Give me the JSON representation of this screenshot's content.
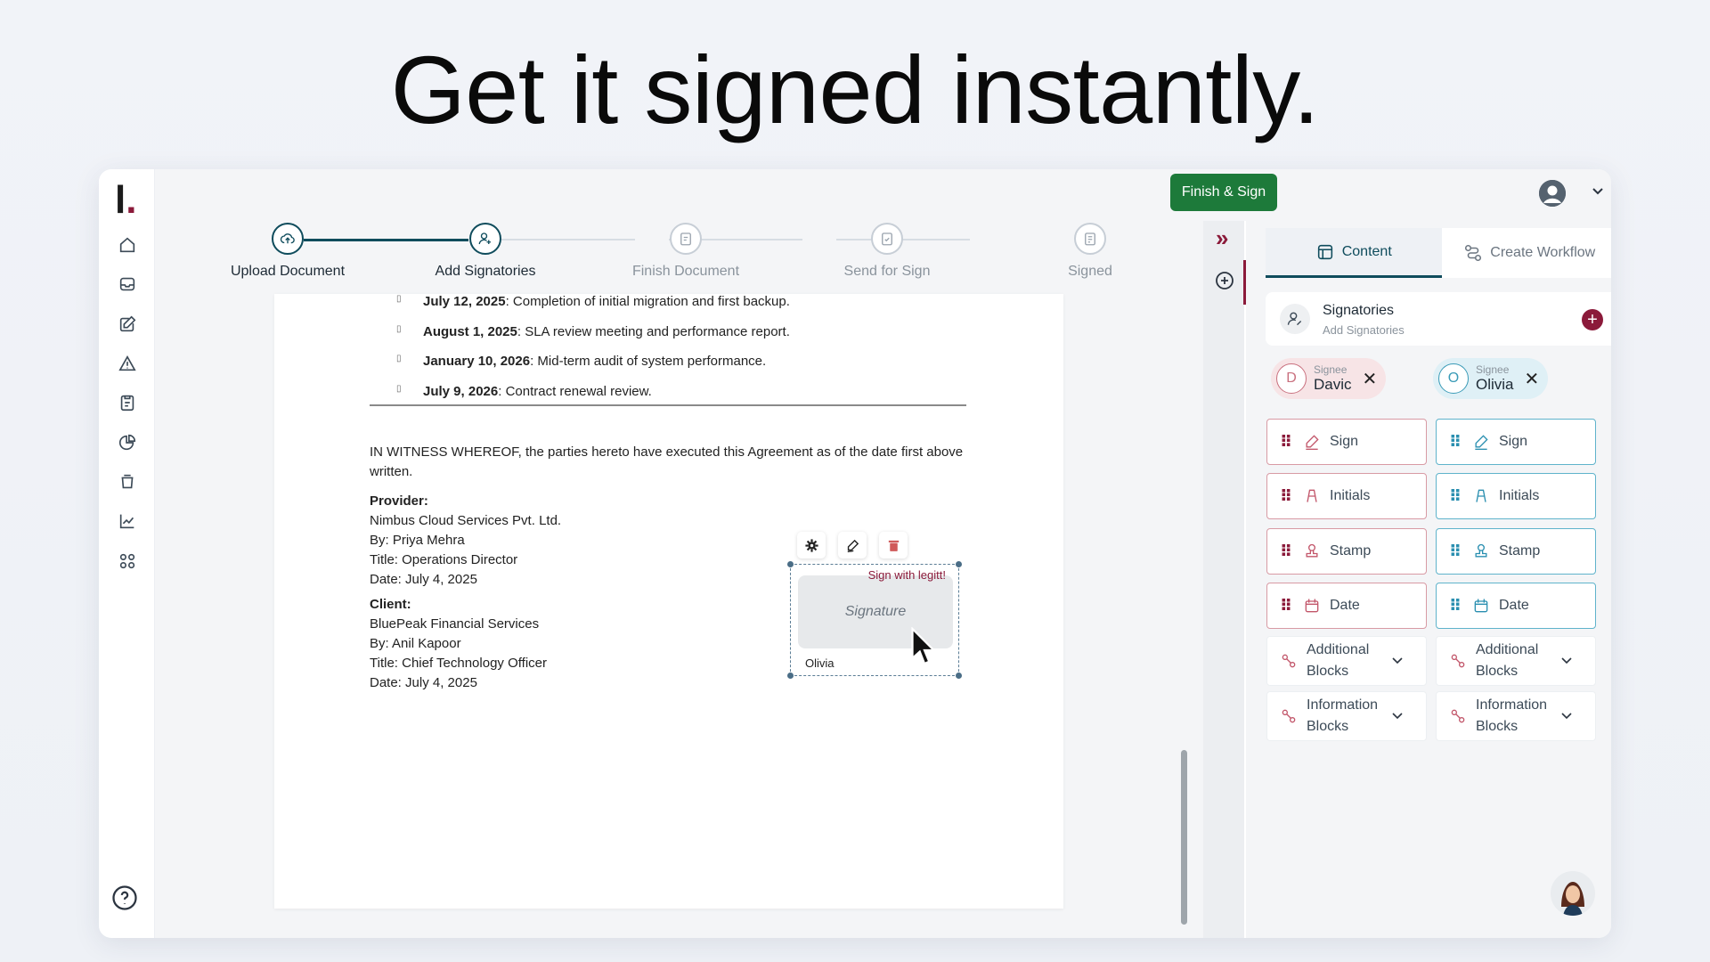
{
  "headline": "Get it signed instantly.",
  "app": {
    "logo": "l.",
    "finish_sign_label": "Finish & Sign"
  },
  "stepper": [
    {
      "label": "Upload Document",
      "state": "done"
    },
    {
      "label": "Add Signatories",
      "state": "current"
    },
    {
      "label": "Finish Document",
      "state": "pending"
    },
    {
      "label": "Send for Sign",
      "state": "pending"
    },
    {
      "label": "Signed",
      "state": "pending"
    }
  ],
  "document": {
    "milestones": [
      {
        "date": "July 12, 2025",
        "text": ": Completion of initial migration and first backup."
      },
      {
        "date": "August 1, 2025",
        "text": ": SLA review meeting and performance report."
      },
      {
        "date": "January 10, 2026",
        "text": ": Mid-term audit of system performance."
      },
      {
        "date": "July 9, 2026",
        "text": ": Contract renewal review."
      }
    ],
    "witness_line1": "IN WITNESS WHEREOF, the parties hereto have executed this Agreement as of the date first above",
    "witness_line2": "written.",
    "provider": {
      "heading": "Provider:",
      "lines": [
        "Nimbus Cloud Services Pvt. Ltd.",
        "By: Priya Mehra",
        "Title: Operations Director",
        "Date: July 4, 2025"
      ]
    },
    "client": {
      "heading": "Client:",
      "lines": [
        "BluePeak Financial Services",
        "By: Anil Kapoor",
        "Title: Chief Technology Officer",
        "Date: July 4, 2025"
      ]
    },
    "signature_field": {
      "tag": "Sign with legitt!",
      "placeholder": "Signature",
      "owner": "Olivia"
    }
  },
  "panel": {
    "tabs": [
      {
        "label": "Content",
        "active": true,
        "icon": "content-icon"
      },
      {
        "label": "Create Workflow",
        "active": false,
        "icon": "workflow-icon"
      }
    ],
    "signatories": {
      "title": "Signatories",
      "subtitle": "Add Signatories"
    },
    "signees": [
      {
        "role": "Signee",
        "name": "Davic",
        "initial": "D",
        "color": "#c9707e"
      },
      {
        "role": "Signee",
        "name": "Olivia",
        "initial": "O",
        "color": "#3a9bb7"
      }
    ],
    "signees_badge": "+",
    "field_blocks": {
      "left": [
        {
          "label": "Sign",
          "icon": "pen-icon"
        },
        {
          "label": "Initials",
          "icon": "initials-icon"
        },
        {
          "label": "Stamp",
          "icon": "stamp-icon"
        },
        {
          "label": "Date",
          "icon": "calendar-icon"
        }
      ],
      "right": [
        {
          "label": "Sign",
          "icon": "pen-icon"
        },
        {
          "label": "Initials",
          "icon": "initials-icon"
        },
        {
          "label": "Stamp",
          "icon": "stamp-icon"
        },
        {
          "label": "Date",
          "icon": "calendar-icon"
        }
      ]
    },
    "expandables": [
      {
        "line1": "Additional",
        "line2": "Blocks"
      },
      {
        "line1": "Additional",
        "line2": "Blocks"
      },
      {
        "line1": "Information",
        "line2": "Blocks"
      },
      {
        "line1": "Information",
        "line2": "Blocks"
      }
    ]
  },
  "colors": {
    "brand": "#8b1a3a",
    "primary_teal": "#0f4c5c",
    "finish_green": "#1d7a3a",
    "signee_red": "#c9707e",
    "signee_teal": "#3a9bb7"
  }
}
